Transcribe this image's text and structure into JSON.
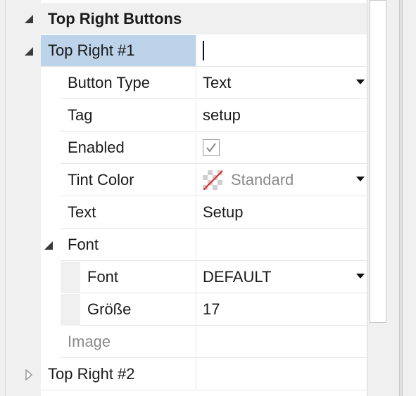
{
  "properties": {
    "section_title": "Top Right Buttons",
    "item1": {
      "label": "Top Right #1",
      "value": "",
      "rows": {
        "button_type": {
          "label": "Button Type",
          "value": "Text"
        },
        "tag": {
          "label": "Tag",
          "value": "setup"
        },
        "enabled": {
          "label": "Enabled",
          "checked": true
        },
        "tint_color": {
          "label": "Tint Color",
          "value": "Standard"
        },
        "text": {
          "label": "Text",
          "value": "Setup"
        },
        "font_group": {
          "label": "Font",
          "font": {
            "label": "Font",
            "value": "DEFAULT"
          },
          "size": {
            "label": "Größe",
            "value": "17"
          }
        },
        "image": {
          "label": "Image",
          "value": ""
        }
      }
    },
    "item2": {
      "label": "Top Right #2",
      "value": ""
    }
  },
  "icons": {
    "expanded": "triangle-down-icon",
    "collapsed": "triangle-right-icon",
    "dropdown": "dropdown-arrow-icon",
    "checkbox": "checkmark-icon",
    "color_swatch": "transparent-swatch-icon"
  },
  "colors": {
    "selection": "#bcd3e9",
    "gutter": "#f0f0f0",
    "swatch_slash": "#e02020"
  }
}
